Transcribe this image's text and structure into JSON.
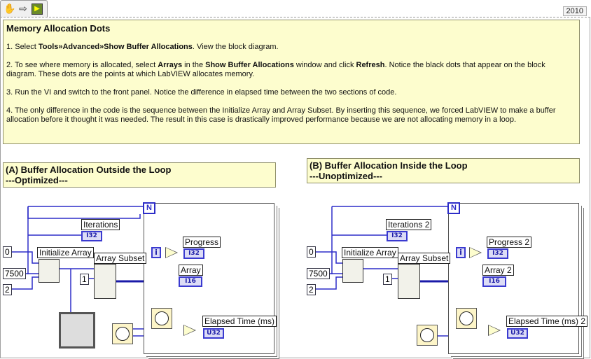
{
  "toolbar": {
    "icons": [
      "hand-icon",
      "arrow-icon",
      "run-vi-icon"
    ]
  },
  "version": "2010",
  "main_note": {
    "title": "Memory Allocation Dots",
    "step1_pre": "1. Select ",
    "step1_bold": "Tools»Advanced»Show Buffer Allocations",
    "step1_post": ". View the block diagram.",
    "step2_pre": "2. To see where memory is allocated, select ",
    "step2_b1": "Arrays",
    "step2_mid1": " in the ",
    "step2_b2": "Show Buffer Allocations",
    "step2_mid2": " window and click ",
    "step2_b3": "Refresh",
    "step2_post": ". Notice the black dots that appear on the block diagram. These dots are the points at which LabVIEW allocates memory.",
    "step3": "3. Run the VI and switch to the front panel. Notice the difference in elapsed time between the two sections of code.",
    "step4": "4. The only difference in the code is the sequence between the Initialize Array and Array Subset. By inserting this sequence, we forced LabVIEW to make a buffer allocation before it thought it was needed. The result in this case is drastically improved performance because we are not allocating memory in a loop."
  },
  "section_a": {
    "title": "(A) Buffer Allocation Outside the Loop",
    "subtitle": "---Optimized---",
    "loop_count": "N",
    "const_zero": "0",
    "const_size": "7500",
    "const_two": "2",
    "const_one": "1",
    "initialize_array": "Initialize Array",
    "array_subset": "Array Subset",
    "iterations": "Iterations",
    "iterations_type": "I32",
    "progress": "Progress",
    "progress_type": "I32",
    "array": "Array",
    "array_type": "I16",
    "elapsed": "Elapsed Time (ms)",
    "elapsed_type": "U32",
    "index": "i"
  },
  "section_b": {
    "title": "(B) Buffer Allocation Inside the Loop",
    "subtitle": "---Unoptimized---",
    "loop_count": "N",
    "const_zero": "0",
    "const_size": "7500",
    "const_two": "2",
    "const_one": "1",
    "initialize_array": "Initialize Array",
    "array_subset": "Array Subset",
    "iterations": "Iterations 2",
    "iterations_type": "I32",
    "progress": "Progress 2",
    "progress_type": "I32",
    "array": "Array 2",
    "array_type": "I16",
    "elapsed": "Elapsed Time (ms) 2",
    "elapsed_type": "U32",
    "index": "i"
  }
}
